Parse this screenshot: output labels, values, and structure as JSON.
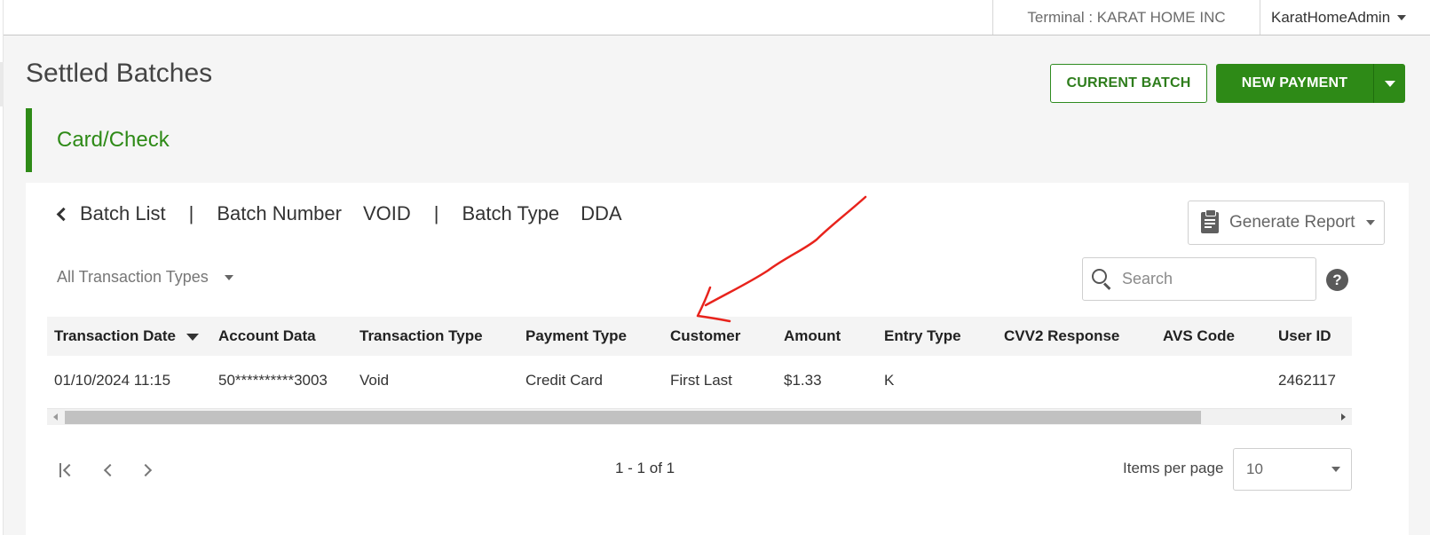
{
  "topbar": {
    "terminal": "Terminal : KARAT HOME INC",
    "user": "KaratHomeAdmin"
  },
  "page": {
    "title": "Settled Batches",
    "current_batch_label": "CURRENT BATCH",
    "new_payment_label": "NEW PAYMENT",
    "section_title": "Card/Check"
  },
  "breadcrumb": {
    "back_label": "Batch List",
    "separator": "|",
    "batch_number_label": "Batch Number",
    "batch_number_value": "VOID",
    "batch_type_label": "Batch Type",
    "batch_type_value": "DDA"
  },
  "toolbar": {
    "generate_report": "Generate Report",
    "filter": "All Transaction Types",
    "search_placeholder": "Search",
    "help": "?"
  },
  "table": {
    "columns": [
      "Transaction Date",
      "Account Data",
      "Transaction Type",
      "Payment Type",
      "Customer",
      "Amount",
      "Entry Type",
      "CVV2 Response",
      "AVS Code",
      "User ID"
    ],
    "rows": [
      [
        "01/10/2024 11:15",
        "50**********3003",
        "Void",
        "Credit Card",
        "First Last",
        "$1.33",
        "K",
        "",
        "",
        "2462117"
      ]
    ]
  },
  "pager": {
    "info": "1 - 1 of 1",
    "items_per_page_label": "Items per page",
    "items_per_page_value": "10"
  },
  "colors": {
    "accent_green": "#2e8a17",
    "annotation_red": "#e8231c"
  }
}
